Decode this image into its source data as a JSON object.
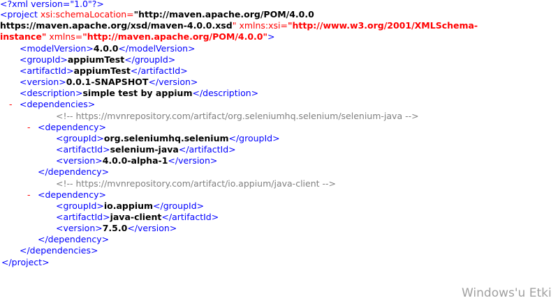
{
  "xml": {
    "declaration": "<?xml version=\"1.0\"?>",
    "project": {
      "open_tag": "<project",
      "attr_schema_name": "xsi:schemaLocation=",
      "attr_schema_value_part1": "\"http://maven.apache.org/POM/4.0.0",
      "attr_schema_value_part2": "https://maven.apache.org/xsd/maven-4.0.0.xsd",
      "attr_schema_value_close": "\"",
      "attr_xsi_name": "xmlns:xsi=",
      "attr_xsi_value_part1": "\"http://www.w3.org/2001/XMLSchema-",
      "attr_xsi_value_part2": "instance\"",
      "attr_xmlns_name": "xmlns=",
      "attr_xmlns_value": "\"http://maven.apache.org/POM/4.0.0\"",
      "open_tag_end": ">",
      "close_tag": "</project>"
    },
    "elements": {
      "model_version": {
        "open": "<modelVersion>",
        "value": "4.0.0",
        "close": "</modelVersion>"
      },
      "group_id": {
        "open": "<groupId>",
        "value": "appiumTest",
        "close": "</groupId>"
      },
      "artifact_id": {
        "open": "<artifactId>",
        "value": "appiumTest",
        "close": "</artifactId>"
      },
      "version": {
        "open": "<version>",
        "value": "0.0.1-SNAPSHOT",
        "close": "</version>"
      },
      "description": {
        "open": "<description>",
        "value": "simple test by appium",
        "close": "</description>"
      }
    },
    "dependencies": {
      "toggle": "-",
      "open": "<dependencies>",
      "close": "</dependencies>",
      "items": [
        {
          "comment": "<!-- https://mvnrepository.com/artifact/org.seleniumhq.selenium/selenium-java -->",
          "toggle": "-",
          "open": "<dependency>",
          "group_id": {
            "open": "<groupId>",
            "value": "org.seleniumhq.selenium",
            "close": "</groupId>"
          },
          "artifact_id": {
            "open": "<artifactId>",
            "value": "selenium-java",
            "close": "</artifactId>"
          },
          "version": {
            "open": "<version>",
            "value": "4.0.0-alpha-1",
            "close": "</version>"
          },
          "close": "</dependency>"
        },
        {
          "comment": "<!-- https://mvnrepository.com/artifact/io.appium/java-client -->",
          "toggle": "-",
          "open": "<dependency>",
          "group_id": {
            "open": "<groupId>",
            "value": "io.appium",
            "close": "</groupId>"
          },
          "artifact_id": {
            "open": "<artifactId>",
            "value": "java-client",
            "close": "</artifactId>"
          },
          "version": {
            "open": "<version>",
            "value": "7.5.0",
            "close": "</version>"
          },
          "close": "</dependency>"
        }
      ]
    }
  },
  "watermark": "Windows'u Etki",
  "colors": {
    "tag": "#0000ff",
    "attribute": "#ff0000",
    "value": "#000000",
    "comment": "#808080",
    "toggle": "#ff0000"
  }
}
